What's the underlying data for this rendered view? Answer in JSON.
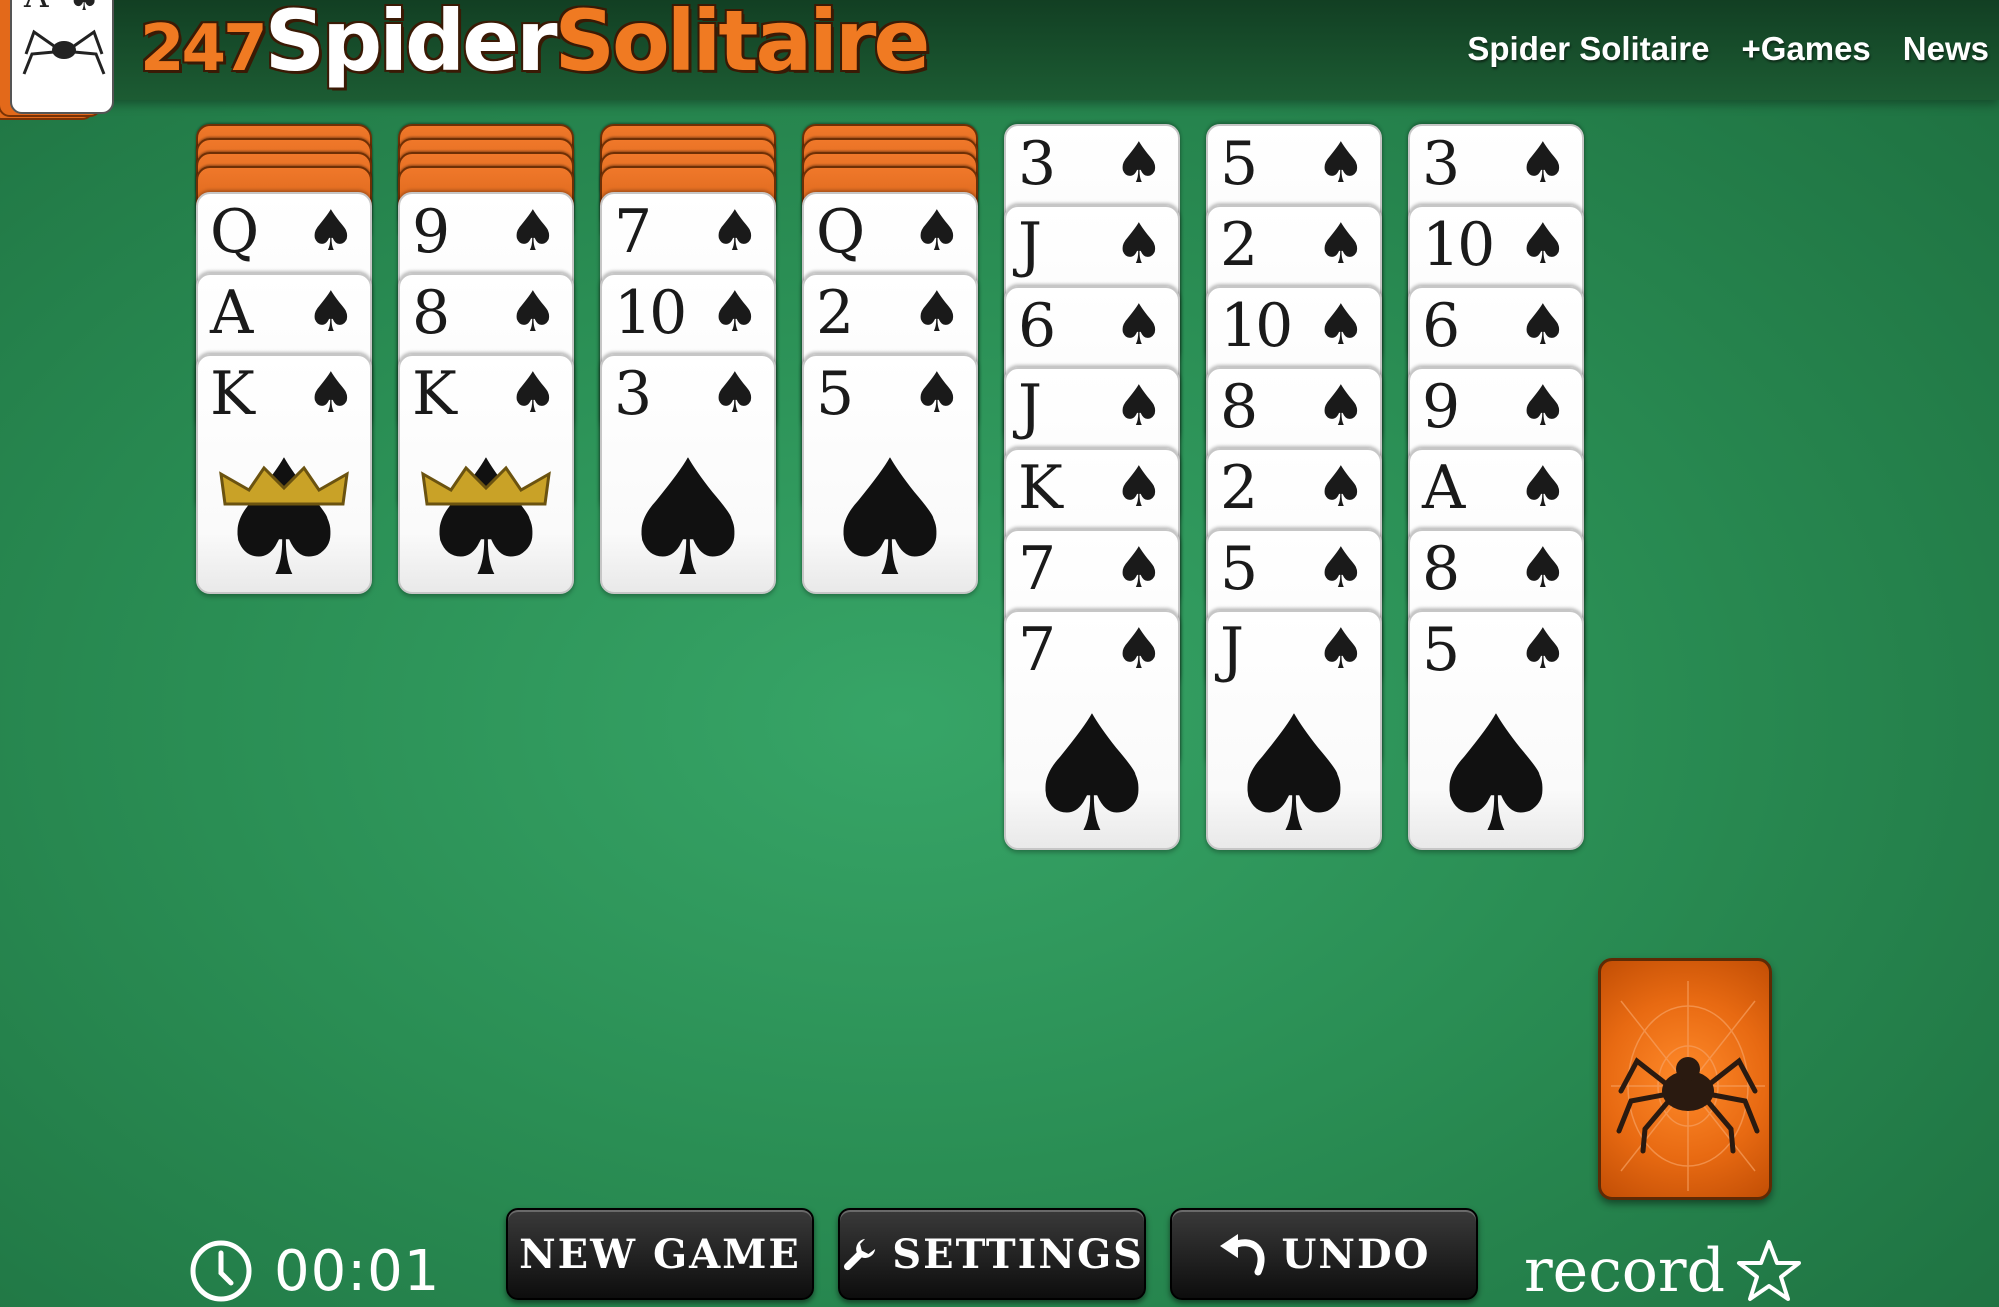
{
  "header": {
    "logo_card": {
      "rank": "A",
      "suit": "♠"
    },
    "title_number": "247",
    "title_word_1": "Spider",
    "title_word_2": "Solitaire",
    "nav": [
      {
        "label": "Spider Solitaire"
      },
      {
        "label": "+Games"
      },
      {
        "label": "News"
      }
    ]
  },
  "tableau": [
    {
      "facedown_count": 4,
      "faceup": [
        "Q",
        "A",
        "K"
      ]
    },
    {
      "facedown_count": 4,
      "faceup": [
        "9",
        "8",
        "K"
      ]
    },
    {
      "facedown_count": 4,
      "faceup": [
        "7",
        "10",
        "3"
      ]
    },
    {
      "facedown_count": 4,
      "faceup": [
        "Q",
        "2",
        "5"
      ]
    },
    {
      "facedown_count": 0,
      "faceup": [
        "3",
        "J",
        "6",
        "J",
        "K",
        "7",
        "7"
      ]
    },
    {
      "facedown_count": 0,
      "faceup": [
        "5",
        "2",
        "10",
        "8",
        "2",
        "5",
        "J"
      ]
    },
    {
      "facedown_count": 0,
      "faceup": [
        "3",
        "10",
        "6",
        "9",
        "A",
        "8",
        "5"
      ]
    }
  ],
  "suit_symbol": "♠",
  "stock": {
    "icon": "spider-icon"
  },
  "bottom": {
    "timer": "00:01",
    "new_game": "NEW GAME",
    "settings": "SETTINGS",
    "undo": "UNDO",
    "record": "record"
  },
  "colors": {
    "felt": "#2a8e54",
    "card_back": "#e86a12",
    "header": "#123f23"
  }
}
